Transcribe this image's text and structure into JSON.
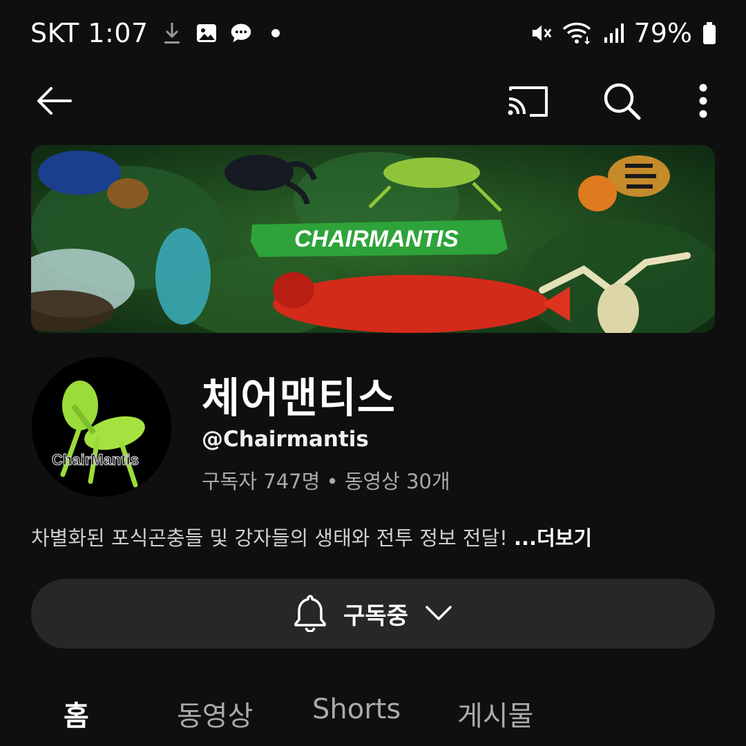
{
  "status_bar": {
    "carrier_time": "SKT 1:07",
    "battery_percent": "79%",
    "icons": [
      "download-icon",
      "gallery-icon",
      "message-icon",
      "dot-icon",
      "mute-icon",
      "wifi-icon",
      "signal-icon",
      "battery-icon"
    ]
  },
  "app_bar": {
    "icons": [
      "back-arrow-icon",
      "cast-icon",
      "search-icon",
      "more-vert-icon"
    ]
  },
  "banner": {
    "text": "CHAIRMANTIS"
  },
  "avatar": {
    "text": "ChairMantis"
  },
  "channel": {
    "name": "체어맨티스",
    "handle": "@Chairmantis",
    "stats": "구독자 747명 • 동영상 30개",
    "description": "차별화된 포식곤충들 및 강자들의 생태와 전투 정보 전달!",
    "more_label": "...더보기"
  },
  "subscribe": {
    "label": "구독중"
  },
  "tabs": [
    {
      "label": "홈",
      "active": true
    },
    {
      "label": "동영상",
      "active": false
    },
    {
      "label": "Shorts",
      "active": false
    },
    {
      "label": "게시물",
      "active": false
    }
  ],
  "colors": {
    "background": "#0f0f0f",
    "surface": "#272727",
    "text_primary": "#f1f1f1",
    "text_secondary": "#aaaaaa",
    "banner_green": "#2e8b2e"
  }
}
